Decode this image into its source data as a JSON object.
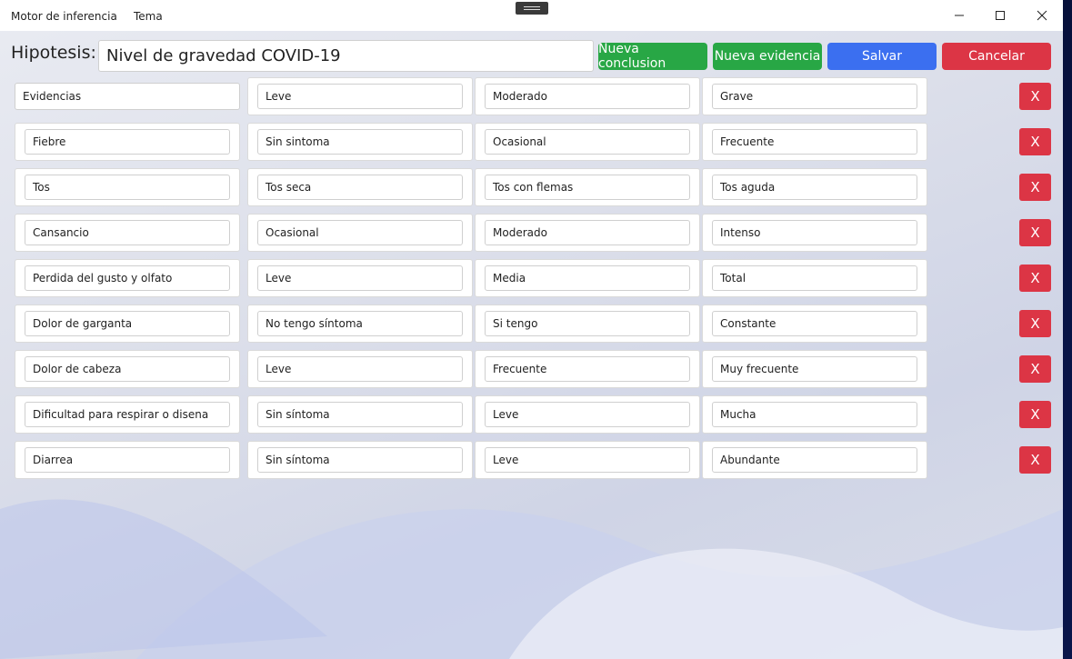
{
  "menu": {
    "app_title": "Motor de inferencia",
    "theme": "Tema"
  },
  "icons": {
    "minimize": "minimize-icon",
    "maximize": "maximize-icon",
    "close": "close-icon"
  },
  "hypothesis": {
    "label": "Hipotesis:",
    "value": "Nivel de gravedad COVID-19"
  },
  "toolbar": {
    "new_conclusion": "Nueva conclusion",
    "new_evidence": "Nueva evidencia",
    "save": "Salvar",
    "cancel": "Cancelar"
  },
  "colors": {
    "green": "#28a745",
    "blue": "#3b6ff0",
    "red": "#dc3545"
  },
  "delete_label": "X",
  "rows": [
    [
      "Evidencias",
      "Leve",
      "Moderado",
      "Grave"
    ],
    [
      "Fiebre",
      "Sin sintoma",
      "Ocasional",
      "Frecuente"
    ],
    [
      "Tos",
      "Tos seca",
      "Tos con flemas",
      "Tos aguda"
    ],
    [
      "Cansancio",
      "Ocasional",
      "Moderado",
      "Intenso"
    ],
    [
      "Perdida del gusto y olfato",
      "Leve",
      "Media",
      "Total"
    ],
    [
      "Dolor de garganta",
      "No tengo síntoma",
      "Si tengo",
      "Constante"
    ],
    [
      "Dolor de cabeza",
      "Leve",
      "Frecuente",
      "Muy frecuente"
    ],
    [
      "Dificultad para respirar o disena",
      "Sin síntoma",
      "Leve",
      "Mucha"
    ],
    [
      "Diarrea",
      "Sin síntoma",
      "Leve",
      "Abundante"
    ]
  ]
}
